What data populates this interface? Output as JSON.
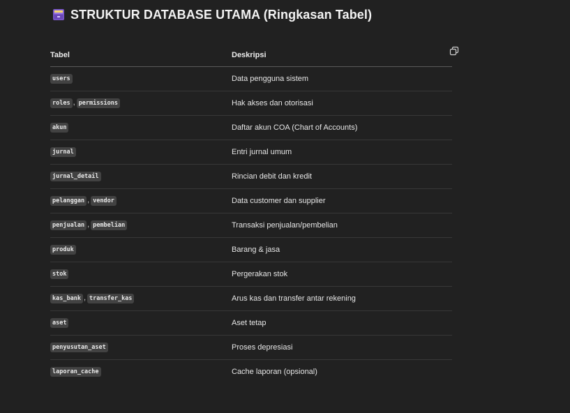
{
  "heading": {
    "icon": "card-file-box-emoji-icon",
    "title": "STRUKTUR DATABASE UTAMA (Ringkasan Tabel)"
  },
  "table": {
    "columns": [
      "Tabel",
      "Deskripsi"
    ],
    "copy_icon": "copy-icon",
    "rows": [
      {
        "names": [
          "users"
        ],
        "desc": "Data pengguna sistem"
      },
      {
        "names": [
          "roles",
          "permissions"
        ],
        "desc": "Hak akses dan otorisasi"
      },
      {
        "names": [
          "akun"
        ],
        "desc": "Daftar akun COA (Chart of Accounts)"
      },
      {
        "names": [
          "jurnal"
        ],
        "desc": "Entri jurnal umum"
      },
      {
        "names": [
          "jurnal_detail"
        ],
        "desc": "Rincian debit dan kredit"
      },
      {
        "names": [
          "pelanggan",
          "vendor"
        ],
        "desc": "Data customer dan supplier"
      },
      {
        "names": [
          "penjualan",
          "pembelian"
        ],
        "desc": "Transaksi penjualan/pembelian"
      },
      {
        "names": [
          "produk"
        ],
        "desc": "Barang & jasa"
      },
      {
        "names": [
          "stok"
        ],
        "desc": "Pergerakan stok"
      },
      {
        "names": [
          "kas_bank",
          "transfer_kas"
        ],
        "desc": "Arus kas dan transfer antar rekening"
      },
      {
        "names": [
          "aset"
        ],
        "desc": "Aset tetap"
      },
      {
        "names": [
          "penyusutan_aset"
        ],
        "desc": "Proses depresiasi"
      },
      {
        "names": [
          "laporan_cache"
        ],
        "desc": "Cache laporan (opsional)"
      }
    ],
    "separator": ","
  },
  "colors": {
    "background": "#212121",
    "text": "#ececec",
    "code_background": "#424242",
    "row_divider": "#383838",
    "header_divider": "#5a5a5a"
  }
}
